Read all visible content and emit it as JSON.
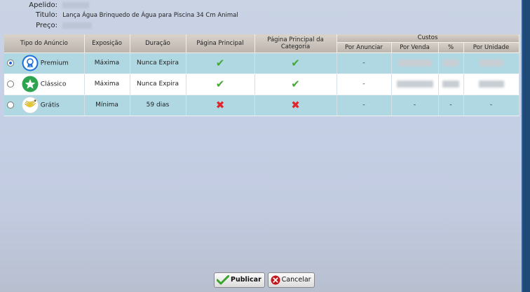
{
  "header": {
    "apelido_label": "Apelido:",
    "titulo_label": "Titulo:",
    "titulo_value": "Lança Água Brinquedo de Água para Piscina 34 Cm Animal",
    "preco_label": "Preço:"
  },
  "table": {
    "headers": {
      "tipo": "Tipo do Anúncio",
      "exposicao": "Exposição",
      "duracao": "Duração",
      "pagina_principal": "Página Principal",
      "pagina_principal_categoria": "Página Principal da Categoria",
      "custos": "Custos",
      "por_anunciar": "Por Anunciar",
      "por_venda": "Por Venda",
      "percent": "%",
      "por_unidade": "Por Unidade"
    },
    "rows": [
      {
        "selected": true,
        "icon": "premium-medal-icon",
        "type": "Premium",
        "exposicao": "Máxima",
        "duracao": "Nunca Expira",
        "pagina_principal": "check",
        "pagina_categoria": "check",
        "por_anunciar": "-"
      },
      {
        "selected": false,
        "icon": "classic-star-icon",
        "type": "Clássico",
        "exposicao": "Máxima",
        "duracao": "Nunca Expira",
        "pagina_principal": "check",
        "pagina_categoria": "check",
        "por_anunciar": "-"
      },
      {
        "selected": false,
        "icon": "free-bananas-icon",
        "type": "Grátis",
        "exposicao": "Mínima",
        "duracao": "59 dias",
        "pagina_principal": "cross",
        "pagina_categoria": "cross",
        "por_anunciar": "-",
        "por_venda": "-",
        "percent": "-",
        "por_unidade": "-"
      }
    ]
  },
  "buttons": {
    "publish_label": "Publicar",
    "cancel_label": "Cancelar"
  },
  "colors": {
    "row_highlight": "#afd8e3",
    "check": "#46a836",
    "cross": "#e2252b",
    "frame": "#2f5f99"
  }
}
